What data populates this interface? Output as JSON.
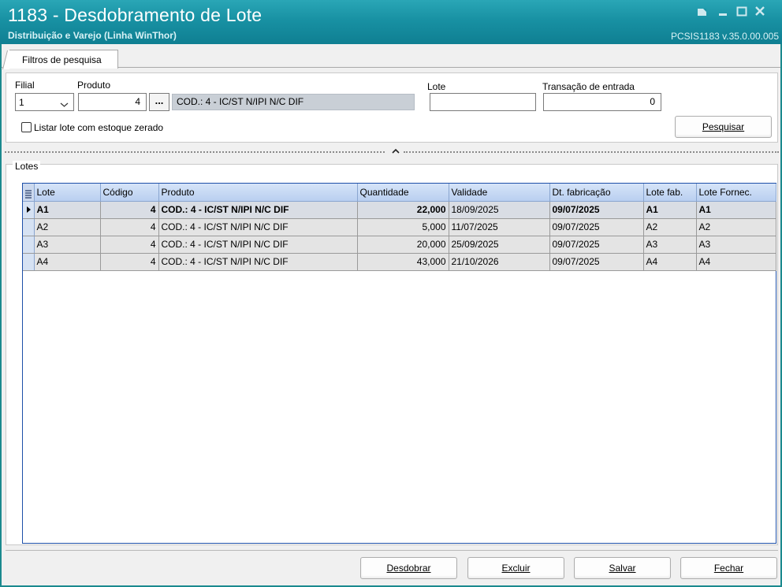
{
  "window": {
    "title": "1183 - Desdobramento de Lote",
    "subtitle": "Distribuição e Varejo (Linha WinThor)",
    "version": "PCSIS1183  v.35.0.00.005"
  },
  "tabs": [
    {
      "label": "Filtros de pesquisa",
      "active": true
    }
  ],
  "filters": {
    "filial": {
      "label": "Filial",
      "value": "1"
    },
    "produto": {
      "label": "Produto",
      "code": "4",
      "description": "COD.: 4 - IC/ST N/IPI N/C DIF",
      "lookup_label": "..."
    },
    "lote": {
      "label": "Lote",
      "value": ""
    },
    "transacao": {
      "label": "Transação de entrada",
      "value": "0"
    },
    "listar_zerado": {
      "label": "Listar lote com estoque zerado",
      "checked": false
    },
    "pesquisar_label": "Pesquisar"
  },
  "lotes": {
    "title": "Lotes",
    "columns": [
      "Lote",
      "Código",
      "Produto",
      "Quantidade",
      "Validade",
      "Dt. fabricação",
      "Lote fab.",
      "Lote Fornec."
    ],
    "rows": [
      {
        "lote": "A1",
        "codigo": "4",
        "produto": "COD.: 4 - IC/ST N/IPI N/C DIF",
        "quantidade": "22,000",
        "validade": "18/09/2025",
        "fabricacao": "09/07/2025",
        "lote_fab": "A1",
        "lote_fornec": "A1"
      },
      {
        "lote": "A2",
        "codigo": "4",
        "produto": "COD.: 4 - IC/ST N/IPI N/C DIF",
        "quantidade": "5,000",
        "validade": "11/07/2025",
        "fabricacao": "09/07/2025",
        "lote_fab": "A2",
        "lote_fornec": "A2"
      },
      {
        "lote": "A3",
        "codigo": "4",
        "produto": "COD.: 4 - IC/ST N/IPI N/C DIF",
        "quantidade": "20,000",
        "validade": "25/09/2025",
        "fabricacao": "09/07/2025",
        "lote_fab": "A3",
        "lote_fornec": "A3"
      },
      {
        "lote": "A4",
        "codigo": "4",
        "produto": "COD.: 4 - IC/ST N/IPI N/C DIF",
        "quantidade": "43,000",
        "validade": "21/10/2026",
        "fabricacao": "09/07/2025",
        "lote_fab": "A4",
        "lote_fornec": "A4"
      }
    ],
    "selected_row": 0
  },
  "actions": {
    "desdobrar": "Desdobrar",
    "excluir": "Excluir",
    "salvar": "Salvar",
    "fechar": "Fechar"
  },
  "colors": {
    "titlebar": "#1891a3",
    "grid_border": "#1d4fa8",
    "header_bg": "#b9cff0",
    "row_bg": "#e4e4e4"
  },
  "icons": [
    "restore-icon",
    "minimize-icon",
    "maximize-icon",
    "close-icon",
    "chevron-down-icon",
    "row-pointer-icon",
    "column-chooser-icon",
    "collapse-arrow-icon"
  ]
}
